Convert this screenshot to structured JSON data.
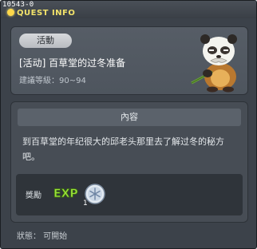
{
  "window": {
    "quest_id": "10543-0",
    "title": "QUEST INFO"
  },
  "quest": {
    "category": "活動",
    "title": "[活动] 百草堂的过冬准备",
    "level": "建議等級：90~94"
  },
  "content": {
    "header": "內容",
    "description": "到百草堂的年纪很大的邱老头那里去了解过冬的秘方吧。"
  },
  "reward": {
    "label": "獎勵",
    "exp_text": "EXP",
    "item_count": "1"
  },
  "status": {
    "text": "狀態： 可開始"
  },
  "colors": {
    "title_yellow": "#f3e36a",
    "exp_green": "#9be23a",
    "panel": "#474d55",
    "background": "#3c424a"
  },
  "icons": {
    "npc": "panda-npc-portrait",
    "exp": "exp-icon",
    "item": "snowflake-ornament-icon"
  }
}
